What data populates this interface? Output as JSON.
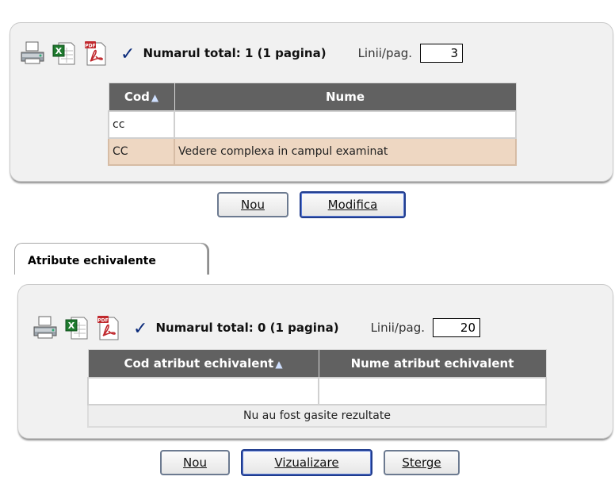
{
  "section1": {
    "total_text": "Numarul total: 1 (1 pagina)",
    "lines_label": "Linii/pag.",
    "lines_value": "3",
    "columns": [
      "Cod",
      "Nume"
    ],
    "rows": [
      {
        "cod": "cc",
        "nume": ""
      },
      {
        "cod": "CC",
        "nume": "Vedere complexa in campul examinat"
      }
    ],
    "buttons": {
      "new": "Nou",
      "modify": "Modifica"
    }
  },
  "tab": {
    "label": "Atribute echivalente"
  },
  "section2": {
    "total_text": "Numarul total: 0 (1 pagina)",
    "lines_label": "Linii/pag.",
    "lines_value": "20",
    "columns": [
      "Cod atribut echivalent",
      "Nume atribut echivalent"
    ],
    "no_results": "Nu au fost gasite rezultate",
    "buttons": {
      "new": "Nou",
      "view": "Vizualizare",
      "delete": "Sterge"
    }
  },
  "icons": [
    "printer-icon",
    "excel-icon",
    "pdf-icon",
    "checkmark-icon",
    "sort-asc-icon"
  ],
  "colors": {
    "header_bg": "#616161",
    "selected_row": "#eed7c2",
    "panel_bg": "#f1f1f1"
  }
}
